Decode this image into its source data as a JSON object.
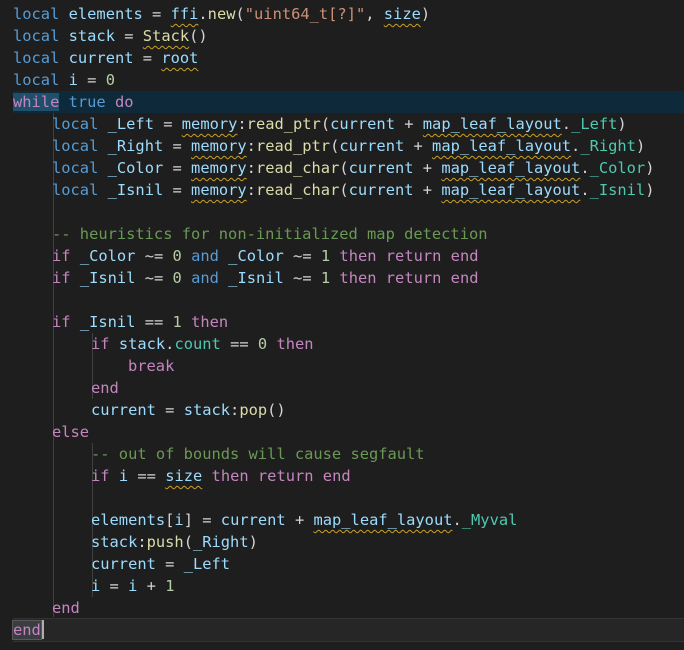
{
  "tokens": {
    "local": "local",
    "while": "while",
    "true": "true",
    "do": "do",
    "if": "if",
    "then": "then",
    "return": "return",
    "end": "end",
    "else": "else",
    "and": "and",
    "break": "break",
    "elements": "elements",
    "stack": "stack",
    "current": "current",
    "root": "root",
    "i": "i",
    "size": "size",
    "ffi": "ffi",
    "new": "new",
    "uint64_str": "\"uint64_t[?]\"",
    "Stack": "Stack",
    "memory": "memory",
    "read_ptr": "read_ptr",
    "read_char": "read_char",
    "map_leaf_layout": "map_leaf_layout",
    "_Left": "_Left",
    "_Right": "_Right",
    "_Color": "_Color",
    "_Isnil": "_Isnil",
    "_Myval": "_Myval",
    "count": "count",
    "pop": "pop",
    "push": "push",
    "zero": "0",
    "one": "1",
    "comment_heuristics": "-- heuristics for non-initialized map detection",
    "comment_bounds": "-- out of bounds will cause segfault",
    "eq": " = ",
    "neq": " ~= ",
    "eqeq": " == ",
    "plus": " + ",
    "dot": ".",
    "colon": ":",
    "comma": ", ",
    "lparen": "(",
    "rparen": ")",
    "parens": "()",
    "lbracket": "[",
    "rbracket": "]",
    "space": " "
  }
}
